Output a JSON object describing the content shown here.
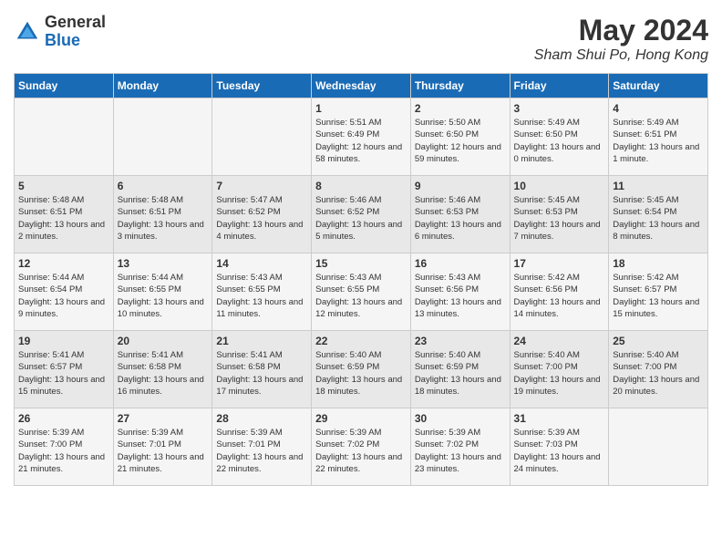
{
  "header": {
    "logo_general": "General",
    "logo_blue": "Blue",
    "month": "May 2024",
    "location": "Sham Shui Po, Hong Kong"
  },
  "days_of_week": [
    "Sunday",
    "Monday",
    "Tuesday",
    "Wednesday",
    "Thursday",
    "Friday",
    "Saturday"
  ],
  "weeks": [
    [
      {
        "day": "",
        "info": ""
      },
      {
        "day": "",
        "info": ""
      },
      {
        "day": "",
        "info": ""
      },
      {
        "day": "1",
        "info": "Sunrise: 5:51 AM\nSunset: 6:49 PM\nDaylight: 12 hours and 58 minutes."
      },
      {
        "day": "2",
        "info": "Sunrise: 5:50 AM\nSunset: 6:50 PM\nDaylight: 12 hours and 59 minutes."
      },
      {
        "day": "3",
        "info": "Sunrise: 5:49 AM\nSunset: 6:50 PM\nDaylight: 13 hours and 0 minutes."
      },
      {
        "day": "4",
        "info": "Sunrise: 5:49 AM\nSunset: 6:51 PM\nDaylight: 13 hours and 1 minute."
      }
    ],
    [
      {
        "day": "5",
        "info": "Sunrise: 5:48 AM\nSunset: 6:51 PM\nDaylight: 13 hours and 2 minutes."
      },
      {
        "day": "6",
        "info": "Sunrise: 5:48 AM\nSunset: 6:51 PM\nDaylight: 13 hours and 3 minutes."
      },
      {
        "day": "7",
        "info": "Sunrise: 5:47 AM\nSunset: 6:52 PM\nDaylight: 13 hours and 4 minutes."
      },
      {
        "day": "8",
        "info": "Sunrise: 5:46 AM\nSunset: 6:52 PM\nDaylight: 13 hours and 5 minutes."
      },
      {
        "day": "9",
        "info": "Sunrise: 5:46 AM\nSunset: 6:53 PM\nDaylight: 13 hours and 6 minutes."
      },
      {
        "day": "10",
        "info": "Sunrise: 5:45 AM\nSunset: 6:53 PM\nDaylight: 13 hours and 7 minutes."
      },
      {
        "day": "11",
        "info": "Sunrise: 5:45 AM\nSunset: 6:54 PM\nDaylight: 13 hours and 8 minutes."
      }
    ],
    [
      {
        "day": "12",
        "info": "Sunrise: 5:44 AM\nSunset: 6:54 PM\nDaylight: 13 hours and 9 minutes."
      },
      {
        "day": "13",
        "info": "Sunrise: 5:44 AM\nSunset: 6:55 PM\nDaylight: 13 hours and 10 minutes."
      },
      {
        "day": "14",
        "info": "Sunrise: 5:43 AM\nSunset: 6:55 PM\nDaylight: 13 hours and 11 minutes."
      },
      {
        "day": "15",
        "info": "Sunrise: 5:43 AM\nSunset: 6:55 PM\nDaylight: 13 hours and 12 minutes."
      },
      {
        "day": "16",
        "info": "Sunrise: 5:43 AM\nSunset: 6:56 PM\nDaylight: 13 hours and 13 minutes."
      },
      {
        "day": "17",
        "info": "Sunrise: 5:42 AM\nSunset: 6:56 PM\nDaylight: 13 hours and 14 minutes."
      },
      {
        "day": "18",
        "info": "Sunrise: 5:42 AM\nSunset: 6:57 PM\nDaylight: 13 hours and 15 minutes."
      }
    ],
    [
      {
        "day": "19",
        "info": "Sunrise: 5:41 AM\nSunset: 6:57 PM\nDaylight: 13 hours and 15 minutes."
      },
      {
        "day": "20",
        "info": "Sunrise: 5:41 AM\nSunset: 6:58 PM\nDaylight: 13 hours and 16 minutes."
      },
      {
        "day": "21",
        "info": "Sunrise: 5:41 AM\nSunset: 6:58 PM\nDaylight: 13 hours and 17 minutes."
      },
      {
        "day": "22",
        "info": "Sunrise: 5:40 AM\nSunset: 6:59 PM\nDaylight: 13 hours and 18 minutes."
      },
      {
        "day": "23",
        "info": "Sunrise: 5:40 AM\nSunset: 6:59 PM\nDaylight: 13 hours and 18 minutes."
      },
      {
        "day": "24",
        "info": "Sunrise: 5:40 AM\nSunset: 7:00 PM\nDaylight: 13 hours and 19 minutes."
      },
      {
        "day": "25",
        "info": "Sunrise: 5:40 AM\nSunset: 7:00 PM\nDaylight: 13 hours and 20 minutes."
      }
    ],
    [
      {
        "day": "26",
        "info": "Sunrise: 5:39 AM\nSunset: 7:00 PM\nDaylight: 13 hours and 21 minutes."
      },
      {
        "day": "27",
        "info": "Sunrise: 5:39 AM\nSunset: 7:01 PM\nDaylight: 13 hours and 21 minutes."
      },
      {
        "day": "28",
        "info": "Sunrise: 5:39 AM\nSunset: 7:01 PM\nDaylight: 13 hours and 22 minutes."
      },
      {
        "day": "29",
        "info": "Sunrise: 5:39 AM\nSunset: 7:02 PM\nDaylight: 13 hours and 22 minutes."
      },
      {
        "day": "30",
        "info": "Sunrise: 5:39 AM\nSunset: 7:02 PM\nDaylight: 13 hours and 23 minutes."
      },
      {
        "day": "31",
        "info": "Sunrise: 5:39 AM\nSunset: 7:03 PM\nDaylight: 13 hours and 24 minutes."
      },
      {
        "day": "",
        "info": ""
      }
    ]
  ]
}
